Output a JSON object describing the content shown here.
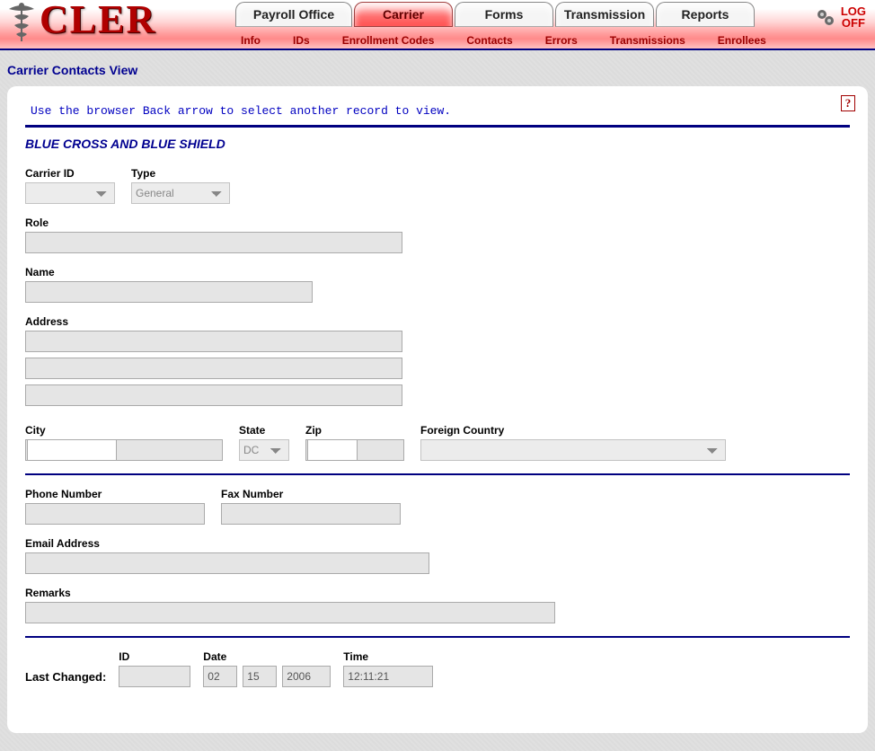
{
  "app": {
    "name": "CLER"
  },
  "header": {
    "tabs": [
      {
        "label": "Payroll Office"
      },
      {
        "label": "Carrier"
      },
      {
        "label": "Forms"
      },
      {
        "label": "Transmission"
      },
      {
        "label": "Reports"
      }
    ],
    "logoff": "LOG\nOFF",
    "subnav": [
      "Info",
      "IDs",
      "Enrollment Codes",
      "Contacts",
      "Errors",
      "Transmissions",
      "Enrollees"
    ]
  },
  "page": {
    "title": "Carrier Contacts View",
    "instruction": "Use the browser Back arrow to select another record to view.",
    "carrier_name": "BLUE CROSS AND BLUE SHIELD",
    "help_glyph": "?"
  },
  "fields": {
    "carrier_id": {
      "label": "Carrier ID",
      "value": ""
    },
    "type": {
      "label": "Type",
      "value": "General"
    },
    "role": {
      "label": "Role",
      "value": ""
    },
    "name": {
      "label": "Name",
      "value": ""
    },
    "address": {
      "label": "Address",
      "lines": [
        "",
        "",
        ""
      ]
    },
    "city": {
      "label": "City",
      "value": ""
    },
    "state": {
      "label": "State",
      "value": "DC"
    },
    "zip": {
      "label": "Zip",
      "value": ""
    },
    "foreign": {
      "label": "Foreign Country",
      "value": ""
    },
    "phone": {
      "label": "Phone Number",
      "value": ""
    },
    "fax": {
      "label": "Fax Number",
      "value": ""
    },
    "email": {
      "label": "Email Address",
      "value": ""
    },
    "remarks": {
      "label": "Remarks",
      "value": ""
    }
  },
  "last_changed": {
    "label": "Last Changed:",
    "id": {
      "label": "ID",
      "value": ""
    },
    "date": {
      "label": "Date",
      "mm": "02",
      "dd": "15",
      "yyyy": "2006"
    },
    "time": {
      "label": "Time",
      "value": "12:11:21"
    }
  }
}
